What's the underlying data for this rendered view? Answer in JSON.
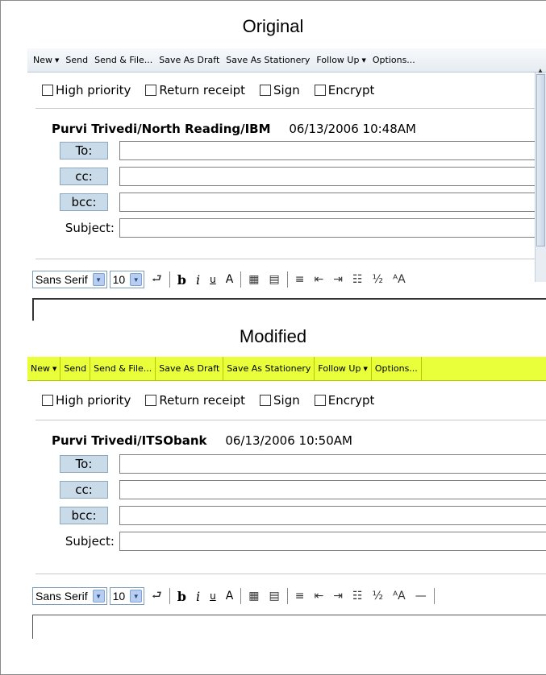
{
  "captions": {
    "original": "Original",
    "modified": "Modified"
  },
  "original": {
    "actions": [
      {
        "label": "New",
        "dropdown": true
      },
      {
        "label": "Send",
        "dropdown": false
      },
      {
        "label": "Send & File...",
        "dropdown": false
      },
      {
        "label": "Save As Draft",
        "dropdown": false
      },
      {
        "label": "Save As Stationery",
        "dropdown": false
      },
      {
        "label": "Follow Up",
        "dropdown": true
      },
      {
        "label": "Options...",
        "dropdown": false
      }
    ],
    "flags": [
      "High priority",
      "Return receipt",
      "Sign",
      "Encrypt"
    ],
    "from": "Purvi Trivedi/North Reading/IBM",
    "date": "06/13/2006 10:48AM",
    "address_buttons": [
      "To:",
      "cc:",
      "bcc:"
    ],
    "subject_label": "Subject:",
    "font_name": "Sans Serif",
    "font_size": "10",
    "accent": "#e6ecf2"
  },
  "modified": {
    "actions": [
      {
        "label": "New",
        "dropdown": true
      },
      {
        "label": "Send",
        "dropdown": false
      },
      {
        "label": "Send & File...",
        "dropdown": false
      },
      {
        "label": "Save As Draft",
        "dropdown": false
      },
      {
        "label": "Save As Stationery",
        "dropdown": false
      },
      {
        "label": "Follow Up",
        "dropdown": true
      },
      {
        "label": "Options...",
        "dropdown": false
      }
    ],
    "flags": [
      "High priority",
      "Return receipt",
      "Sign",
      "Encrypt"
    ],
    "from": "Purvi Trivedi/ITSObank",
    "date": "06/13/2006 10:50AM",
    "address_buttons": [
      "To:",
      "cc:",
      "bcc:"
    ],
    "subject_label": "Subject:",
    "font_name": "Sans Serif",
    "font_size": "10",
    "accent": "#e9ff3a"
  },
  "toolbar_icons": [
    "return-arrow-icon",
    "bold-icon",
    "italic-icon",
    "underline-icon",
    "text-color-icon",
    "insert-table-icon",
    "table-icon",
    "align-icon",
    "outdent-icon",
    "indent-icon",
    "bullets-icon",
    "numbering-icon",
    "text-size-icon",
    "horizontal-rule-icon"
  ]
}
